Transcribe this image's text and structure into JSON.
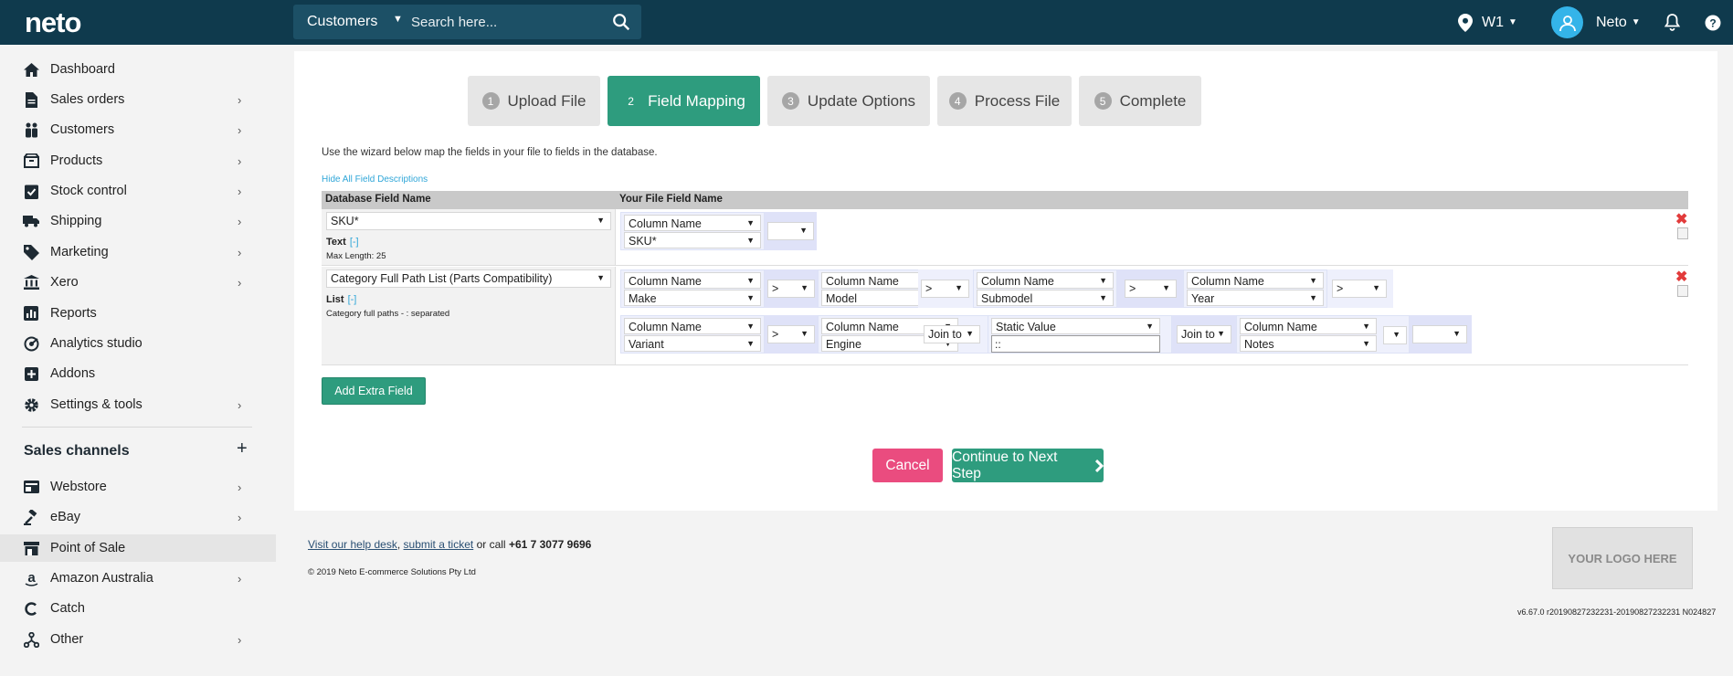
{
  "topbar": {
    "logo": "neto",
    "search_scope": "Customers",
    "search_placeholder": "Search here...",
    "location": "W1",
    "user": "Neto"
  },
  "sidebar": {
    "items": [
      {
        "label": "Dashboard",
        "icon": "home-icon",
        "chevron": false
      },
      {
        "label": "Sales orders",
        "icon": "document-icon",
        "chevron": true
      },
      {
        "label": "Customers",
        "icon": "people-icon",
        "chevron": true
      },
      {
        "label": "Products",
        "icon": "box-icon",
        "chevron": true
      },
      {
        "label": "Stock control",
        "icon": "checklist-icon",
        "chevron": true
      },
      {
        "label": "Shipping",
        "icon": "truck-icon",
        "chevron": true
      },
      {
        "label": "Marketing",
        "icon": "tag-icon",
        "chevron": true
      },
      {
        "label": "Xero",
        "icon": "bank-icon",
        "chevron": true
      },
      {
        "label": "Reports",
        "icon": "bar-chart-icon",
        "chevron": false
      },
      {
        "label": "Analytics studio",
        "icon": "analytics-icon",
        "chevron": false
      },
      {
        "label": "Addons",
        "icon": "plus-square-icon",
        "chevron": false
      },
      {
        "label": "Settings & tools",
        "icon": "gear-icon",
        "chevron": true
      }
    ],
    "channels_heading": "Sales channels",
    "channels": [
      {
        "label": "Webstore",
        "icon": "webstore-icon",
        "chevron": true
      },
      {
        "label": "eBay",
        "icon": "gavel-icon",
        "chevron": true
      },
      {
        "label": "Point of Sale",
        "icon": "pos-icon",
        "chevron": false,
        "active": true
      },
      {
        "label": "Amazon Australia",
        "icon": "amazon-icon",
        "chevron": true
      },
      {
        "label": "Catch",
        "icon": "catch-icon",
        "chevron": false
      },
      {
        "label": "Other",
        "icon": "network-icon",
        "chevron": true
      }
    ]
  },
  "wizard": {
    "steps": [
      {
        "num": "1",
        "label": "Upload File"
      },
      {
        "num": "2",
        "label": "Field Mapping",
        "active": true
      },
      {
        "num": "3",
        "label": "Update Options"
      },
      {
        "num": "4",
        "label": "Process File"
      },
      {
        "num": "5",
        "label": "Complete"
      }
    ],
    "instructions": "Use the wizard below map the fields in your file to fields in the database.",
    "hide_descriptions": "Hide All Field Descriptions",
    "headers": {
      "db": "Database Field Name",
      "file": "Your File Field Name"
    },
    "row1": {
      "db_field": "SKU*",
      "type": "Text",
      "toggle": "[-]",
      "desc": "Max Length: 25",
      "col_type": "Column Name",
      "col_value": "SKU*"
    },
    "row2": {
      "db_field": "Category Full Path List (Parts Compatibility)",
      "type": "List",
      "toggle": "[-]",
      "desc": "Category full paths - : separated",
      "col_type": "Column Name",
      "static_type": "Static Value",
      "static_value": "::",
      "sep": ">",
      "join": "Join to",
      "line1": [
        "Make",
        "Model",
        "Submodel",
        "Year"
      ],
      "line2": [
        "Variant",
        "Engine",
        "Notes"
      ]
    },
    "add_extra": "Add Extra Field",
    "cancel": "Cancel",
    "next": "Continue to Next Step"
  },
  "footer": {
    "help_desk": "Visit our help desk",
    "comma": ",",
    "submit_ticket": "submit a ticket",
    "or_call": "or call",
    "phone": "+61 7 3077 9696",
    "copyright": "© 2019 Neto E-commerce Solutions Pty Ltd",
    "logo_placeholder": "YOUR LOGO HERE",
    "version": "v6.67.0 r20190827232231-20190827232231 N024827"
  }
}
